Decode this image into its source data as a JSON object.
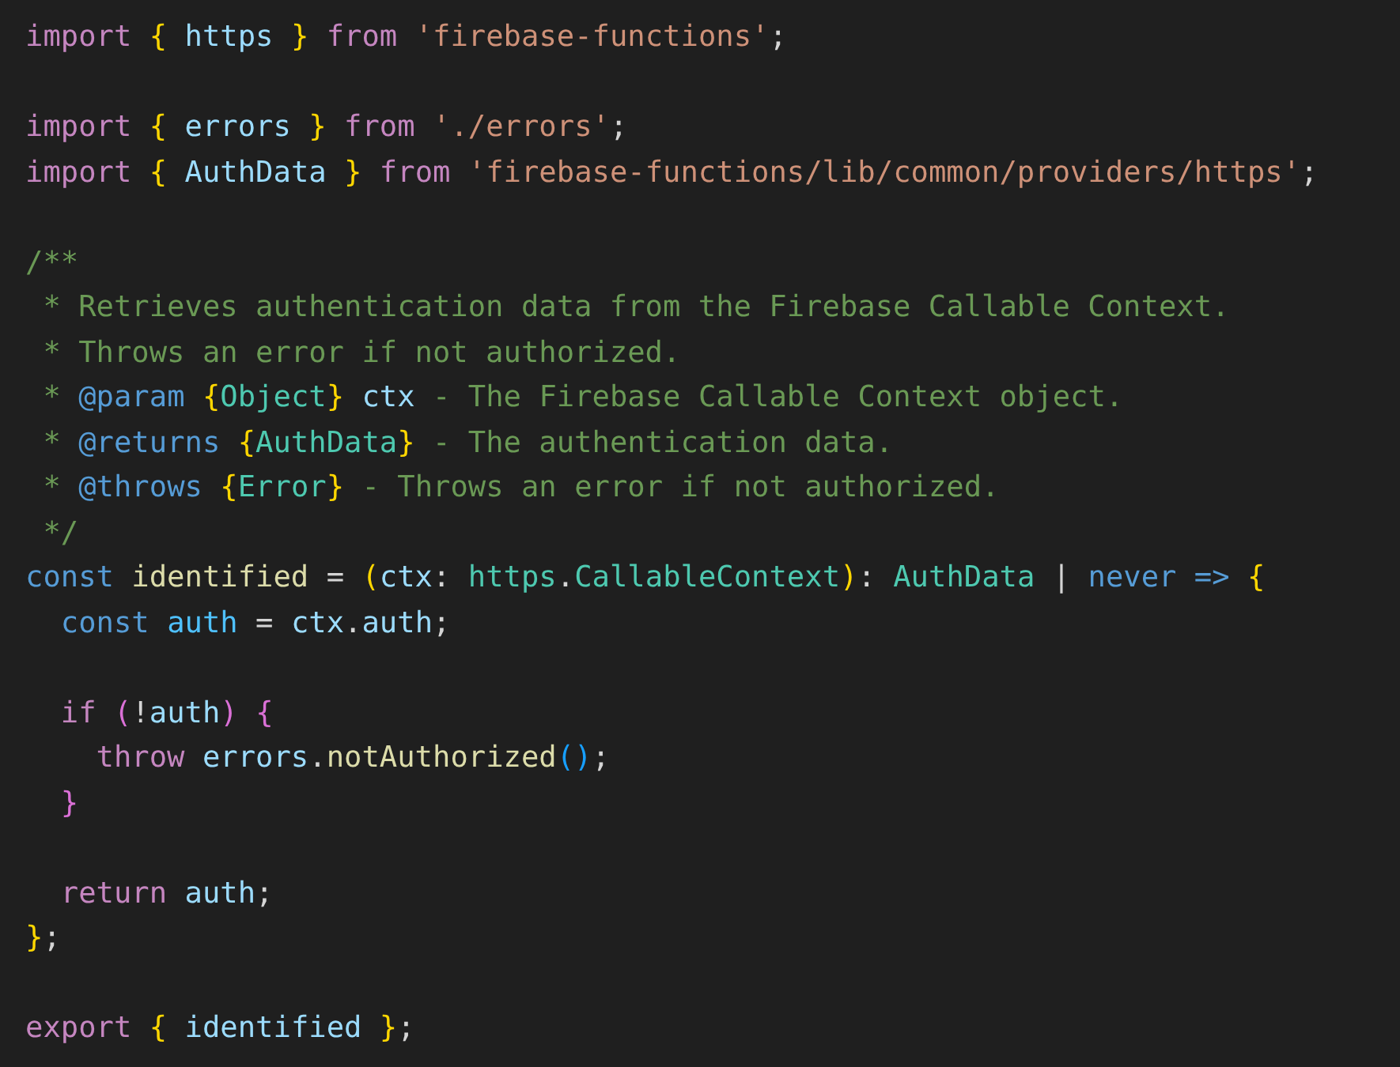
{
  "editor": {
    "lines": [
      {
        "kind": "code",
        "tokens": [
          {
            "text": "import ",
            "kind": "keyword"
          },
          {
            "text": "{",
            "kind": "brace1"
          },
          {
            "text": " https ",
            "kind": "variable"
          },
          {
            "text": "}",
            "kind": "brace1"
          },
          {
            "text": " from ",
            "kind": "keyword"
          },
          {
            "text": "'firebase-functions'",
            "kind": "string"
          },
          {
            "text": ";",
            "kind": "plain"
          }
        ]
      },
      {
        "kind": "blank"
      },
      {
        "kind": "code",
        "tokens": [
          {
            "text": "import ",
            "kind": "keyword"
          },
          {
            "text": "{",
            "kind": "brace1"
          },
          {
            "text": " errors ",
            "kind": "variable"
          },
          {
            "text": "}",
            "kind": "brace1"
          },
          {
            "text": " from ",
            "kind": "keyword"
          },
          {
            "text": "'./errors'",
            "kind": "string"
          },
          {
            "text": ";",
            "kind": "plain"
          }
        ]
      },
      {
        "kind": "code",
        "tokens": [
          {
            "text": "import ",
            "kind": "keyword"
          },
          {
            "text": "{",
            "kind": "brace1"
          },
          {
            "text": " AuthData ",
            "kind": "variable"
          },
          {
            "text": "}",
            "kind": "brace1"
          },
          {
            "text": " from ",
            "kind": "keyword"
          },
          {
            "text": "'firebase-functions/lib/common/providers/https'",
            "kind": "string"
          },
          {
            "text": ";",
            "kind": "plain"
          }
        ]
      },
      {
        "kind": "blank"
      },
      {
        "kind": "code",
        "tokens": [
          {
            "text": "/**",
            "kind": "comment"
          }
        ]
      },
      {
        "kind": "code",
        "tokens": [
          {
            "text": " * Retrieves authentication data from the Firebase Callable Context.",
            "kind": "comment"
          }
        ]
      },
      {
        "kind": "code",
        "tokens": [
          {
            "text": " * Throws an error if not authorized.",
            "kind": "comment"
          }
        ]
      },
      {
        "kind": "code",
        "tokens": [
          {
            "text": " * ",
            "kind": "comment"
          },
          {
            "text": "@param ",
            "kind": "tag"
          },
          {
            "text": "{",
            "kind": "brace1"
          },
          {
            "text": "Object",
            "kind": "type"
          },
          {
            "text": "}",
            "kind": "brace1"
          },
          {
            "text": " ctx",
            "kind": "variable"
          },
          {
            "text": " - The Firebase Callable Context object.",
            "kind": "comment"
          }
        ]
      },
      {
        "kind": "code",
        "tokens": [
          {
            "text": " * ",
            "kind": "comment"
          },
          {
            "text": "@returns ",
            "kind": "tag"
          },
          {
            "text": "{",
            "kind": "brace1"
          },
          {
            "text": "AuthData",
            "kind": "type"
          },
          {
            "text": "}",
            "kind": "brace1"
          },
          {
            "text": " - The authentication data.",
            "kind": "comment"
          }
        ]
      },
      {
        "kind": "code",
        "tokens": [
          {
            "text": " * ",
            "kind": "comment"
          },
          {
            "text": "@throws ",
            "kind": "tag"
          },
          {
            "text": "{",
            "kind": "brace1"
          },
          {
            "text": "Error",
            "kind": "type"
          },
          {
            "text": "}",
            "kind": "brace1"
          },
          {
            "text": " - Throws an error if not authorized.",
            "kind": "comment"
          }
        ]
      },
      {
        "kind": "code",
        "tokens": [
          {
            "text": " */",
            "kind": "comment"
          }
        ]
      },
      {
        "kind": "code",
        "tokens": [
          {
            "text": "const ",
            "kind": "storage"
          },
          {
            "text": "identified",
            "kind": "function"
          },
          {
            "text": " = ",
            "kind": "plain"
          },
          {
            "text": "(",
            "kind": "brace1"
          },
          {
            "text": "ctx",
            "kind": "variable"
          },
          {
            "text": ": ",
            "kind": "plain"
          },
          {
            "text": "https",
            "kind": "type"
          },
          {
            "text": ".",
            "kind": "plain"
          },
          {
            "text": "CallableContext",
            "kind": "type"
          },
          {
            "text": ")",
            "kind": "brace1"
          },
          {
            "text": ": ",
            "kind": "plain"
          },
          {
            "text": "AuthData",
            "kind": "type"
          },
          {
            "text": " | ",
            "kind": "plain"
          },
          {
            "text": "never =>",
            "kind": "storage"
          },
          {
            "text": " {",
            "kind": "brace1"
          }
        ]
      },
      {
        "kind": "code",
        "tokens": [
          {
            "text": "  const ",
            "kind": "storage"
          },
          {
            "text": "auth",
            "kind": "constant"
          },
          {
            "text": " = ",
            "kind": "plain"
          },
          {
            "text": "ctx",
            "kind": "variable"
          },
          {
            "text": ".",
            "kind": "plain"
          },
          {
            "text": "auth",
            "kind": "variable"
          },
          {
            "text": ";",
            "kind": "plain"
          }
        ]
      },
      {
        "kind": "blank"
      },
      {
        "kind": "code",
        "tokens": [
          {
            "text": "  if ",
            "kind": "keyword"
          },
          {
            "text": "(",
            "kind": "brace2"
          },
          {
            "text": "!",
            "kind": "plain"
          },
          {
            "text": "auth",
            "kind": "variable"
          },
          {
            "text": ")",
            "kind": "brace2"
          },
          {
            "text": " {",
            "kind": "brace2"
          }
        ]
      },
      {
        "kind": "code",
        "tokens": [
          {
            "text": "    throw ",
            "kind": "keyword"
          },
          {
            "text": "errors",
            "kind": "variable"
          },
          {
            "text": ".",
            "kind": "plain"
          },
          {
            "text": "notAuthorized",
            "kind": "function"
          },
          {
            "text": "()",
            "kind": "brace3"
          },
          {
            "text": ";",
            "kind": "plain"
          }
        ]
      },
      {
        "kind": "code",
        "tokens": [
          {
            "text": "  }",
            "kind": "brace2"
          }
        ]
      },
      {
        "kind": "blank"
      },
      {
        "kind": "code",
        "tokens": [
          {
            "text": "  return ",
            "kind": "keyword"
          },
          {
            "text": "auth",
            "kind": "variable"
          },
          {
            "text": ";",
            "kind": "plain"
          }
        ]
      },
      {
        "kind": "code",
        "tokens": [
          {
            "text": "}",
            "kind": "brace1"
          },
          {
            "text": ";",
            "kind": "plain"
          }
        ]
      },
      {
        "kind": "blank"
      },
      {
        "kind": "code",
        "tokens": [
          {
            "text": "export ",
            "kind": "keyword"
          },
          {
            "text": "{",
            "kind": "brace1"
          },
          {
            "text": " identified ",
            "kind": "variable"
          },
          {
            "text": "}",
            "kind": "brace1"
          },
          {
            "text": ";",
            "kind": "plain"
          }
        ]
      }
    ]
  }
}
